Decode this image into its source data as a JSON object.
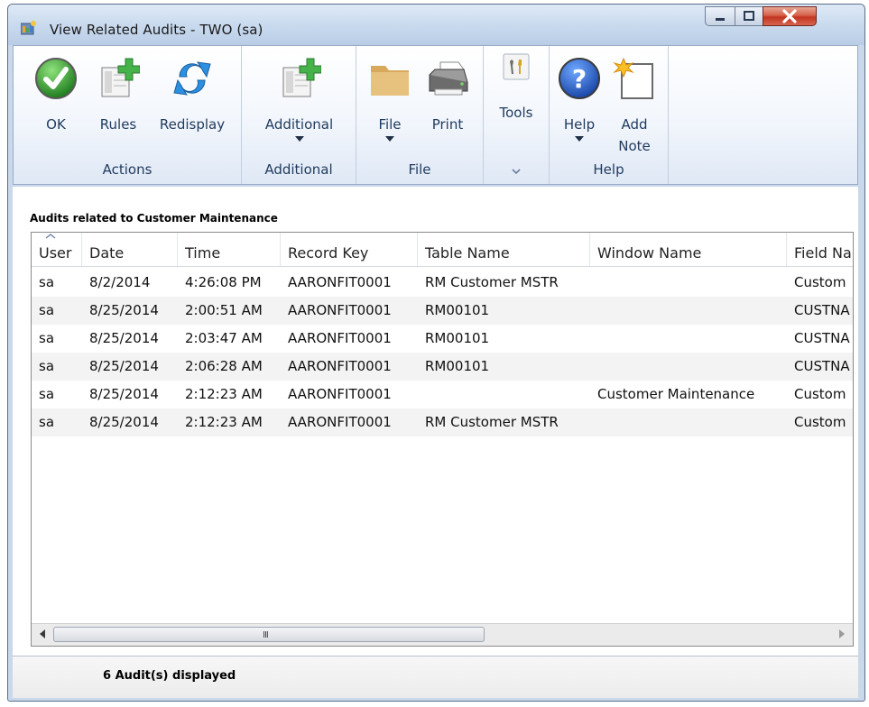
{
  "window": {
    "title": "View Related Audits  -  TWO (sa)",
    "buttons": {
      "minimize": "minimize",
      "maximize": "maximize",
      "close": "close"
    }
  },
  "ribbon": {
    "groups": [
      {
        "label": "Actions",
        "buttons": [
          {
            "label": "OK",
            "icon": "ok-check-icon"
          },
          {
            "label": "Rules",
            "icon": "rules-icon"
          },
          {
            "label": "Redisplay",
            "icon": "redisplay-icon"
          }
        ]
      },
      {
        "label": "Additional",
        "buttons": [
          {
            "label": "Additional",
            "icon": "additional-icon"
          }
        ]
      },
      {
        "label": "File",
        "buttons": [
          {
            "label": "File",
            "icon": "folder-icon"
          },
          {
            "label": "Print",
            "icon": "printer-icon"
          }
        ]
      },
      {
        "label": "",
        "buttons": [
          {
            "label": "Tools",
            "icon": "tools-icon"
          }
        ]
      },
      {
        "label": "Help",
        "buttons": [
          {
            "label": "Help",
            "icon": "help-icon"
          },
          {
            "label": "Add\nNote",
            "label_line1": "Add",
            "label_line2": "Note",
            "icon": "note-icon"
          }
        ]
      }
    ]
  },
  "grid": {
    "caption": "Audits related to Customer Maintenance",
    "columns": [
      "User",
      "Date",
      "Time",
      "Record Key",
      "Table Name",
      "Window Name",
      "Field Na"
    ],
    "rows": [
      [
        "sa",
        "8/2/2014",
        "4:26:08 PM",
        "AARONFIT0001",
        "RM Customer MSTR",
        "",
        "Custom"
      ],
      [
        "sa",
        "8/25/2014",
        "2:00:51 AM",
        "AARONFIT0001",
        "RM00101",
        "",
        "CUSTNA"
      ],
      [
        "sa",
        "8/25/2014",
        "2:03:47 AM",
        "AARONFIT0001",
        "RM00101",
        "",
        "CUSTNA"
      ],
      [
        "sa",
        "8/25/2014",
        "2:06:28 AM",
        "AARONFIT0001",
        "RM00101",
        "",
        "CUSTNA"
      ],
      [
        "sa",
        "8/25/2014",
        "2:12:23 AM",
        "AARONFIT0001",
        "",
        "Customer Maintenance",
        "Custom"
      ],
      [
        "sa",
        "8/25/2014",
        "2:12:23 AM",
        "AARONFIT0001",
        "RM Customer MSTR",
        "",
        "Custom"
      ]
    ],
    "sort_column": "User",
    "scroll_grip": "III"
  },
  "status": {
    "text": "6 Audit(s) displayed"
  },
  "colors": {
    "ribbon_text": "#1f3a5e",
    "ok_green": "#2f9b2f",
    "help_blue": "#1f5fbf",
    "close_red": "#c2341f"
  }
}
